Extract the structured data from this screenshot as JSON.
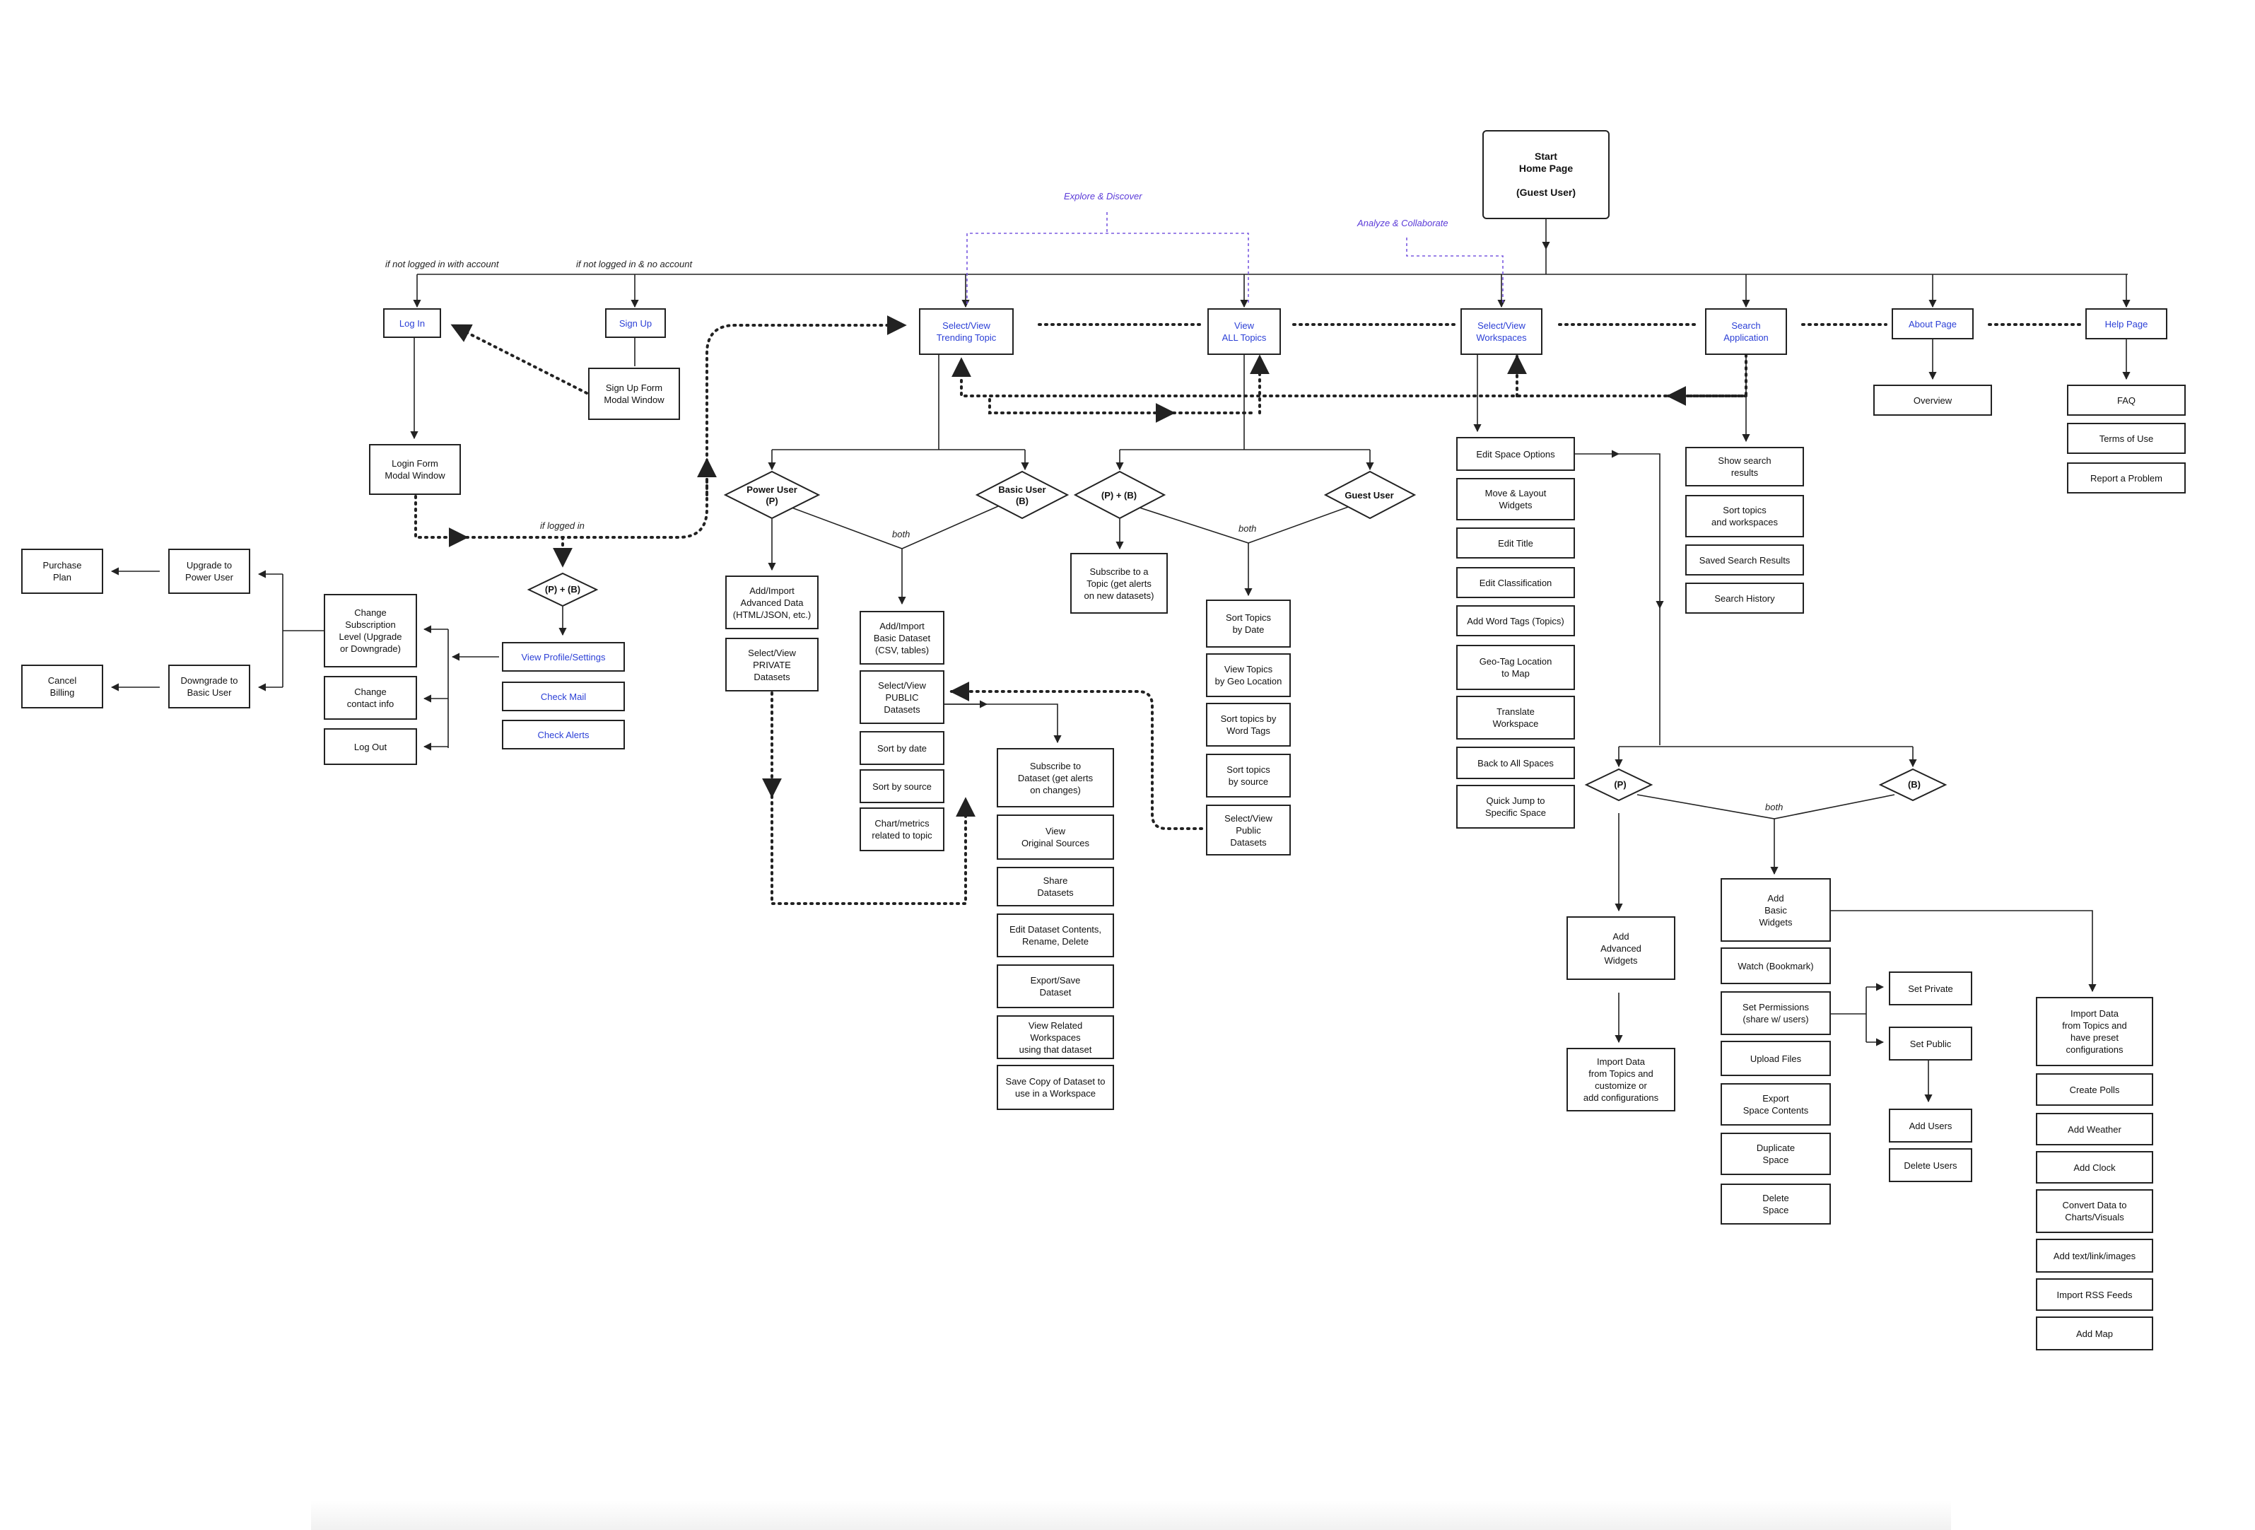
{
  "start": "Start\nHome Page\n\n(Guest User)",
  "nav": {
    "login": "Log In",
    "signup": "Sign Up",
    "trending": "Select/View\nTrending Topic",
    "all_topics": "View\nALL Topics",
    "workspaces": "Select/View\nWorkspaces",
    "search": "Search\nApplication",
    "about": "About Page",
    "help": "Help Page"
  },
  "notes": {
    "not_logged_account": "if not logged in with account",
    "not_logged_no_account": "if not logged in &  no account",
    "explore": "Explore & Discover",
    "analyze": "Analyze & Collaborate",
    "if_logged": "if logged in",
    "both": "both"
  },
  "login_flow": {
    "login_form": "Login Form\nModal Window",
    "signup_form": "Sign Up Form\nModal Window",
    "pb": "(P) + (B)",
    "view_profile": "View Profile/Settings",
    "check_mail": "Check Mail",
    "check_alerts": "Check Alerts",
    "change_sub": "Change\nSubscription\nLevel (Upgrade\nor Downgrade)",
    "change_contact": "Change\ncontact info",
    "logout": "Log Out",
    "upgrade": "Upgrade to\nPower User",
    "downgrade": "Downgrade to\nBasic User",
    "purchase": "Purchase\nPlan",
    "cancel": "Cancel\nBilling"
  },
  "trending_flow": {
    "power_user": "Power User\n(P)",
    "basic_user": "Basic User\n(B)",
    "add_advanced": "Add/Import\nAdvanced Data\n(HTML/JSON, etc.)",
    "private_datasets": "Select/View\nPRIVATE\nDatasets",
    "add_basic": "Add/Import\nBasic Dataset\n(CSV, tables)",
    "public_datasets": "Select/View\nPUBLIC\nDatasets",
    "sort_date": "Sort by date",
    "sort_source": "Sort by source",
    "chart_metrics": "Chart/metrics\nrelated to topic",
    "subscribe_dataset": "Subscribe to\nDataset (get alerts\non changes)",
    "view_sources": "View\nOriginal Sources",
    "share": "Share\nDatasets",
    "edit_dataset": "Edit Dataset Contents,\nRename, Delete",
    "export_dataset": "Export/Save\nDataset",
    "related_ws": "View Related Workspaces\nusing that dataset",
    "save_copy": "Save Copy of Dataset to\nuse in a Workspace"
  },
  "topics_flow": {
    "pb": "(P) + (B)",
    "guest": "Guest User",
    "subscribe_topic": "Subscribe to a\nTopic (get alerts\non new datasets)",
    "sort_date": "Sort Topics\nby Date",
    "geo": "View Topics\nby Geo Location",
    "word_tags": "Sort topics by\nWord Tags",
    "source": "Sort topics\nby source",
    "public": "Select/View\nPublic\nDatasets"
  },
  "workspace_flow": {
    "edit_options": "Edit Space Options",
    "move_layout": "Move & Layout\nWidgets",
    "edit_title": "Edit Title",
    "edit_class": "Edit Classification",
    "word_tags": "Add Word Tags (Topics)",
    "geo_tag": "Geo-Tag Location\nto Map",
    "translate": "Translate\nWorkspace",
    "back": "Back to All Spaces",
    "quick_jump": "Quick Jump to\nSpecific Space",
    "p": "(P)",
    "b": "(B)",
    "add_advanced": "Add\nAdvanced\nWidgets",
    "import_custom": "Import Data\nfrom Topics and\ncustomize or\nadd configurations",
    "add_basic": "Add\nBasic\nWidgets",
    "watch": "Watch (Bookmark)",
    "permissions": "Set Permissions\n(share w/ users)",
    "upload": "Upload Files",
    "export": "Export\nSpace Contents",
    "duplicate": "Duplicate\nSpace",
    "delete": "Delete\nSpace",
    "set_private": "Set Private",
    "set_public": "Set Public",
    "add_users": "Add Users",
    "delete_users": "Delete Users",
    "import_preset": "Import Data\nfrom Topics and\nhave preset\nconfigurations",
    "polls": "Create Polls",
    "weather": "Add Weather",
    "clock": "Add Clock",
    "convert": "Convert Data to\nCharts/Visuals",
    "text_link": "Add text/link/images",
    "rss": "Import RSS Feeds",
    "map": "Add Map"
  },
  "search_flow": {
    "results": "Show search\nresults",
    "sort": "Sort topics\nand workspaces",
    "saved": "Saved Search Results",
    "history": "Search History"
  },
  "about_flow": {
    "overview": "Overview"
  },
  "help_flow": {
    "faq": "FAQ",
    "terms": "Terms of Use",
    "report": "Report a Problem"
  }
}
